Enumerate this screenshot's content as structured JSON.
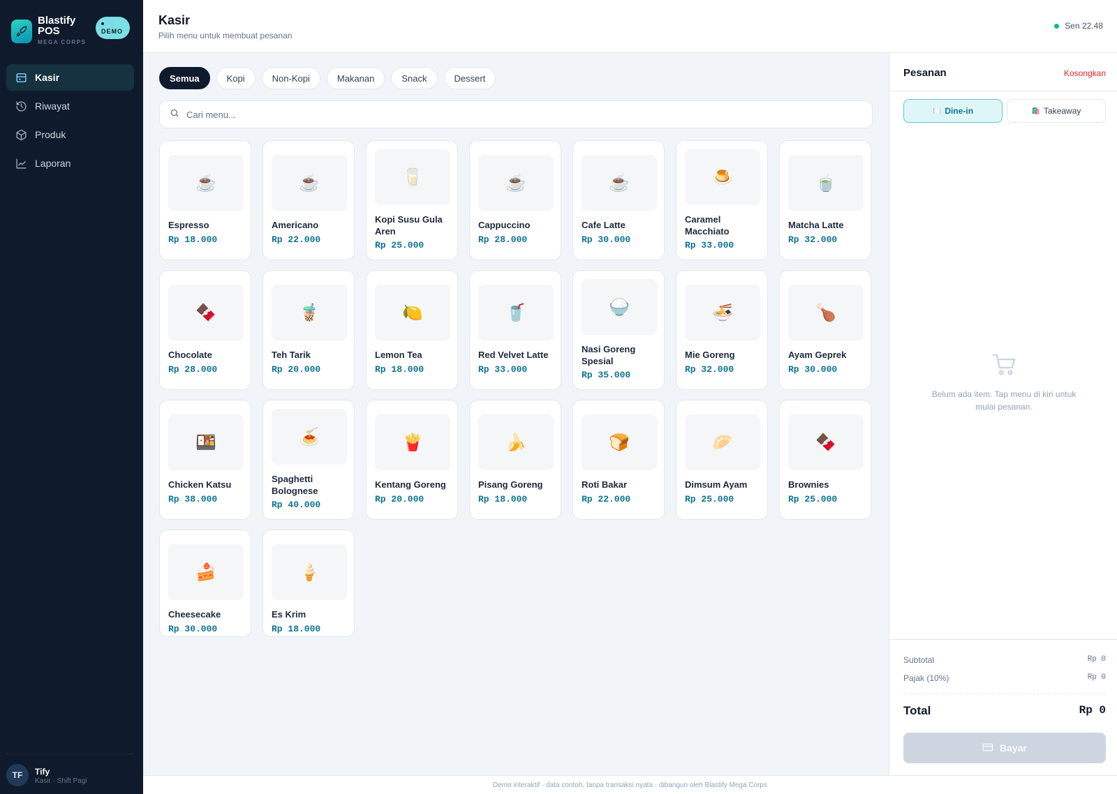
{
  "brand": {
    "name": "Blastify POS",
    "sub": "MEGA CORPS",
    "badge": "DEMO"
  },
  "nav": [
    {
      "label": "Kasir",
      "icon": "cashier-icon",
      "active": true
    },
    {
      "label": "Riwayat",
      "icon": "history-icon",
      "active": false
    },
    {
      "label": "Produk",
      "icon": "box-icon",
      "active": false
    },
    {
      "label": "Laporan",
      "icon": "chart-icon",
      "active": false
    }
  ],
  "user": {
    "initials": "TF",
    "name": "Tify",
    "role": "Kasir · Shift Pagi"
  },
  "header": {
    "title": "Kasir",
    "subtitle": "Pilih menu untuk membuat pesanan",
    "clock": "Sen 22.48"
  },
  "categories": [
    "Semua",
    "Kopi",
    "Non-Kopi",
    "Makanan",
    "Snack",
    "Dessert"
  ],
  "search": {
    "placeholder": "Cari menu..."
  },
  "products": [
    {
      "name": "Espresso",
      "price": "Rp 18.000",
      "emoji": "☕"
    },
    {
      "name": "Americano",
      "price": "Rp 22.000",
      "emoji": "☕"
    },
    {
      "name": "Kopi Susu Gula Aren",
      "price": "Rp 25.000",
      "emoji": "🥛"
    },
    {
      "name": "Cappuccino",
      "price": "Rp 28.000",
      "emoji": "☕"
    },
    {
      "name": "Cafe Latte",
      "price": "Rp 30.000",
      "emoji": "☕"
    },
    {
      "name": "Caramel Macchiato",
      "price": "Rp 33.000",
      "emoji": "🍮"
    },
    {
      "name": "Matcha Latte",
      "price": "Rp 32.000",
      "emoji": "🍵"
    },
    {
      "name": "Chocolate",
      "price": "Rp 28.000",
      "emoji": "🍫"
    },
    {
      "name": "Teh Tarik",
      "price": "Rp 20.000",
      "emoji": "🧋"
    },
    {
      "name": "Lemon Tea",
      "price": "Rp 18.000",
      "emoji": "🍋"
    },
    {
      "name": "Red Velvet Latte",
      "price": "Rp 33.000",
      "emoji": "🥤"
    },
    {
      "name": "Nasi Goreng Spesial",
      "price": "Rp 35.000",
      "emoji": "🍚"
    },
    {
      "name": "Mie Goreng",
      "price": "Rp 32.000",
      "emoji": "🍜"
    },
    {
      "name": "Ayam Geprek",
      "price": "Rp 30.000",
      "emoji": "🍗"
    },
    {
      "name": "Chicken Katsu",
      "price": "Rp 38.000",
      "emoji": "🍱"
    },
    {
      "name": "Spaghetti Bolognese",
      "price": "Rp 40.000",
      "emoji": "🍝"
    },
    {
      "name": "Kentang Goreng",
      "price": "Rp 20.000",
      "emoji": "🍟"
    },
    {
      "name": "Pisang Goreng",
      "price": "Rp 18.000",
      "emoji": "🍌"
    },
    {
      "name": "Roti Bakar",
      "price": "Rp 22.000",
      "emoji": "🍞"
    },
    {
      "name": "Dimsum Ayam",
      "price": "Rp 25.000",
      "emoji": "🥟"
    },
    {
      "name": "Brownies",
      "price": "Rp 25.000",
      "emoji": "🍫"
    },
    {
      "name": "Cheesecake",
      "price": "Rp 30.000",
      "emoji": "🍰"
    },
    {
      "name": "Es Krim",
      "price": "Rp 18.000",
      "emoji": "🍦"
    }
  ],
  "order": {
    "title": "Pesanan",
    "clear_label": "Kosongkan",
    "mode_dinein": "Dine-in",
    "mode_takeaway": "Takeaway",
    "empty_text": "Belum ada item. Tap menu di kiri untuk mulai pesanan.",
    "subtotal_label": "Subtotal",
    "subtotal_value": "Rp 0",
    "tax_label": "Pajak (10%)",
    "tax_value": "Rp 0",
    "total_label": "Total",
    "total_value": "Rp 0",
    "pay_label": "Bayar"
  },
  "footer": {
    "text": "Demo interaktif · data contoh, tanpa transaksi nyata · dibangun oleh Blastify Mega Corps"
  },
  "colors": {
    "sidebar": "#0f1b2d",
    "accent": "#0e7490",
    "danger": "#dc2626"
  }
}
